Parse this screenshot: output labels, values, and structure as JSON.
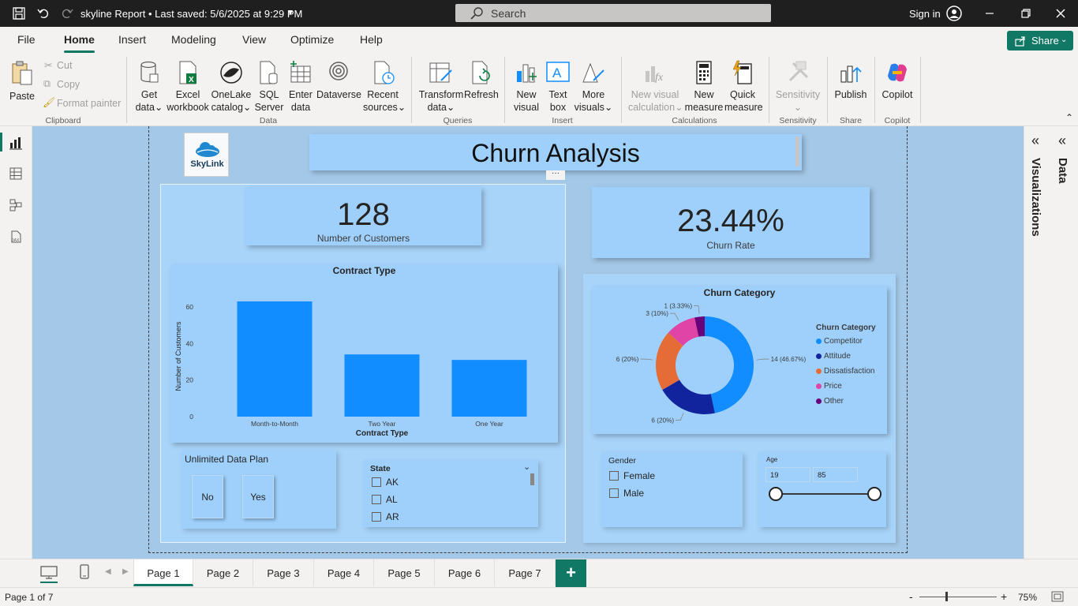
{
  "titlebar": {
    "title": "skyline Report • Last saved: 5/6/2025 at 9:29 PM",
    "search_placeholder": "Search",
    "sign_in": "Sign in"
  },
  "menu": {
    "items": [
      "File",
      "Home",
      "Insert",
      "Modeling",
      "View",
      "Optimize",
      "Help"
    ],
    "active": "Home",
    "share": "Share"
  },
  "ribbon": {
    "clipboard": {
      "paste": "Paste",
      "cut": "Cut",
      "copy": "Copy",
      "format_painter": "Format painter",
      "group": "Clipboard"
    },
    "data": {
      "get_data": [
        "Get",
        "data"
      ],
      "excel": [
        "Excel",
        "workbook"
      ],
      "onelake": [
        "OneLake",
        "catalog"
      ],
      "sql": [
        "SQL",
        "Server"
      ],
      "enter": [
        "Enter",
        "data"
      ],
      "dataverse": "Dataverse",
      "recent": [
        "Recent",
        "sources"
      ],
      "group": "Data"
    },
    "queries": {
      "transform": [
        "Transform",
        "data"
      ],
      "refresh": "Refresh",
      "group": "Queries"
    },
    "insert": {
      "new_visual": [
        "New",
        "visual"
      ],
      "text_box": [
        "Text",
        "box"
      ],
      "more_visuals": [
        "More",
        "visuals"
      ],
      "group": "Insert"
    },
    "calculations": {
      "new_visual_calc": [
        "New visual",
        "calculation"
      ],
      "new_measure": [
        "New",
        "measure"
      ],
      "quick_measure": [
        "Quick",
        "measure"
      ],
      "group": "Calculations"
    },
    "sensitivity": {
      "label": "Sensitivity",
      "group": "Sensitivity"
    },
    "share": {
      "publish": "Publish",
      "group": "Share"
    },
    "copilot": {
      "label": "Copilot",
      "group": "Copilot"
    }
  },
  "report": {
    "logo_text": "SkyLink",
    "title": "Churn Analysis",
    "kpi_customers": {
      "value": "128",
      "label": "Number of Customers"
    },
    "kpi_churn": {
      "value": "23.44%",
      "label": "Churn Rate"
    },
    "contract_chart_title": "Contract Type",
    "churn_chart_title": "Churn Category",
    "unlimited": {
      "title": "Unlimited Data Plan",
      "options": [
        "No",
        "Yes"
      ]
    },
    "state": {
      "title": "State",
      "options": [
        "AK",
        "AL",
        "AR"
      ]
    },
    "gender": {
      "title": "Gender",
      "options": [
        "Female",
        "Male"
      ]
    },
    "age": {
      "title": "Age",
      "min": "19",
      "max": "85"
    }
  },
  "chart_data": [
    {
      "type": "bar",
      "title": "Contract Type",
      "xlabel": "Contract Type",
      "ylabel": "Number of Customers",
      "categories": [
        "Month-to-Month",
        "Two Year",
        "One Year"
      ],
      "values": [
        63,
        34,
        31
      ],
      "ylim": [
        0,
        66
      ],
      "yticks": [
        "0",
        "20",
        "40",
        "60"
      ],
      "color": "#118dff"
    },
    {
      "type": "pie",
      "title": "Churn Category",
      "legend_title": "Churn Category",
      "legend_position": "right",
      "categories": [
        "Competitor",
        "Attitude",
        "Dissatisfaction",
        "Price",
        "Other"
      ],
      "values": [
        14,
        6,
        6,
        3,
        1
      ],
      "labels": [
        "14 (46.67%)",
        "6 (20%)",
        "6 (20%)",
        "3 (10%)",
        "1 (3.33%)"
      ],
      "colors": [
        "#118dff",
        "#12239e",
        "#e66c37",
        "#e044a7",
        "#6b007b"
      ]
    }
  ],
  "right_panes": {
    "visualizations": "Visualizations",
    "data": "Data"
  },
  "pages": {
    "tabs": [
      "Page 1",
      "Page 2",
      "Page 3",
      "Page 4",
      "Page 5",
      "Page 6",
      "Page 7"
    ],
    "active": "Page 1",
    "add": "+"
  },
  "status": {
    "page": "Page 1 of 7",
    "zoom": "75%"
  }
}
